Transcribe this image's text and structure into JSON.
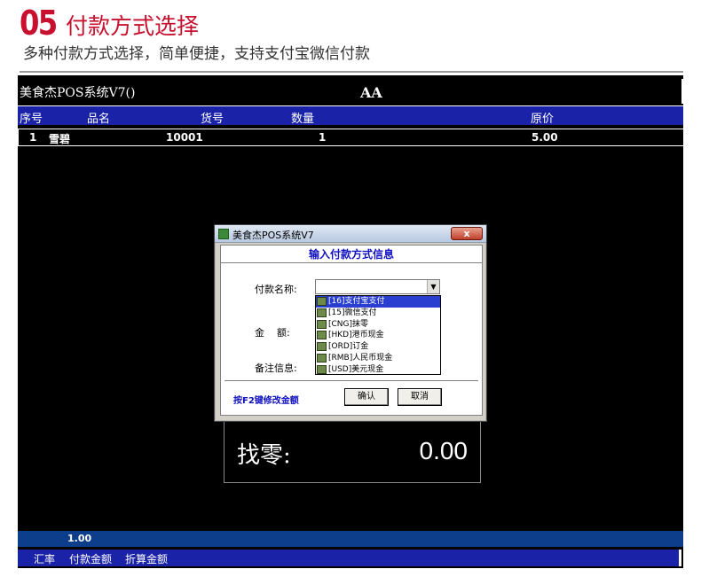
{
  "banner": {
    "number": "05",
    "title": "付款方式选择",
    "subtitle": "多种付款方式选择，简单便捷，支持支付宝微信付款"
  },
  "pos": {
    "app_title": "美食杰POS系统V7()",
    "user": "AA",
    "columns": [
      "序号",
      "品名",
      "货号",
      "数量",
      "原价"
    ],
    "rows": [
      {
        "index": "1",
        "name": "雪碧",
        "code": "10001",
        "qty": "1",
        "price": "5.00"
      }
    ],
    "change_label": "找零:",
    "change_value": "0.00",
    "rate_value": "1.00",
    "footer": [
      "汇率",
      "付款金额",
      "折算金额"
    ]
  },
  "dialog": {
    "title": "美食杰POS系统V7",
    "close": "x",
    "heading": "输入付款方式信息",
    "payment_label": "付款名称:",
    "amount_label": "金    额:",
    "remark_label": "备注信息:",
    "options": [
      {
        "label": "[16]支付宝支付",
        "icon": "alipay-icon"
      },
      {
        "label": "[15]微信支付",
        "icon": "wechat-icon"
      },
      {
        "label": "[CNG]抹零",
        "icon": "round-off-icon"
      },
      {
        "label": "[HKD]港币现金",
        "icon": "hkd-cash-icon"
      },
      {
        "label": "[ORD]订金",
        "icon": "deposit-icon"
      },
      {
        "label": "[RMB]人民币现金",
        "icon": "rmb-cash-icon"
      },
      {
        "label": "[USD]美元现金",
        "icon": "usd-cash-icon"
      }
    ],
    "selected_index": 0,
    "hint": "按F2键修改金额",
    "ok": "确认",
    "cancel": "取消"
  },
  "colors": {
    "brand_red": "#c8102e",
    "header_blue": "#1a22a8",
    "status_blue": "#0c3e8c",
    "dialog_text_blue": "#1010c0",
    "selection_blue": "#2a3fd0"
  }
}
